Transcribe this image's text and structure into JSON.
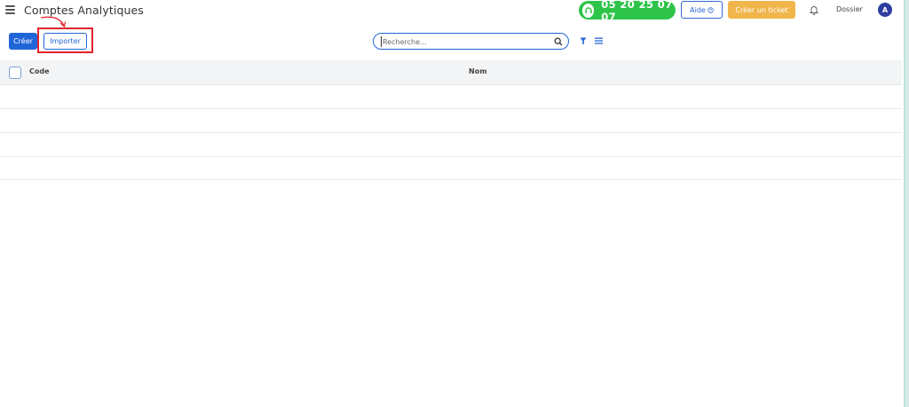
{
  "header": {
    "title": "Comptes Analytiques",
    "phone": "05 20 25 07 07",
    "help_label": "Aide",
    "ticket_label": "Créer un ticket",
    "dossier_label": "Dossier",
    "avatar_initial": "A"
  },
  "toolbar": {
    "create_label": "Créer",
    "import_label": "Importer",
    "search_placeholder": "Recherche..."
  },
  "table": {
    "columns": [
      "Code",
      "Nom"
    ],
    "rows": []
  },
  "colors": {
    "primary": "#2166d9",
    "phone_green": "#2ec44a",
    "ticket_orange": "#f0b54b",
    "highlight_red": "#e0242c",
    "avatar": "#2d3ea1"
  },
  "icons": [
    "menu-icon",
    "headset-icon",
    "help-circle-icon",
    "bell-icon",
    "search-icon",
    "filter-icon",
    "list-icon"
  ]
}
